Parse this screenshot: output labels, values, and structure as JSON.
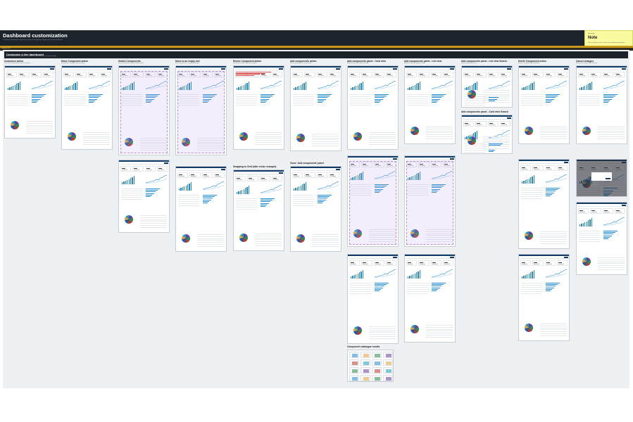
{
  "header": {
    "title": "Dashboard customization",
    "subtitle": "Customize dashboard components, layouts and add new components to the dashboard"
  },
  "note": {
    "label": "Annotation",
    "title": "Note",
    "description": "Click on any link to see the steps for the dashboard customization"
  },
  "strip": {
    "label": "Version 1.0.0"
  },
  "section": {
    "title": "Customize a live dashboard",
    "subtitle": "A user can customize the components on a dashboard and add new ones from a component catalog"
  },
  "columns": [
    {
      "title": "Customize action",
      "desc": "Click on the customize button to enter the edit mode"
    },
    {
      "title": "Move Component action",
      "desc": "Drag and drop a component into a new position"
    },
    {
      "title": "Switch Components",
      "desc": "Drop a component onto another to switch positions"
    },
    {
      "title": "Move to an empty slot",
      "desc": "Drop a component into an empty slot of the grid"
    },
    {
      "title": "Resize Component action",
      "desc": "Drag the corner handle to resize the component"
    },
    {
      "title": "Add components action",
      "desc": "Click on add components to open the panel"
    },
    {
      "title": "Add components panel - Card view",
      "desc": "Browse the component catalog in card view"
    },
    {
      "title": "Add components panel - List view",
      "desc": "Browse the component catalog in list view"
    },
    {
      "title": "Add components panel - List view Search",
      "desc": "Search components in list view"
    },
    {
      "title": "Delete Component action",
      "desc": "Remove a component from the dashboard"
    },
    {
      "title": "Cancel changes",
      "desc": "Discard all the changes made in edit mode"
    }
  ],
  "subtitles": {
    "snapping": "Snapping to Grid (after resize example)",
    "close_panel": "Close 'Add components' panel",
    "card_search": "Add components panel - Card view Search",
    "catalog": "Component catalogue results"
  },
  "colors": {
    "header": "#1d232b",
    "note": "#fafa9e",
    "accent": "#c99a1a",
    "board": "#eef1f4",
    "primary": "#0f3b66",
    "bar": "#1e8bd0"
  }
}
